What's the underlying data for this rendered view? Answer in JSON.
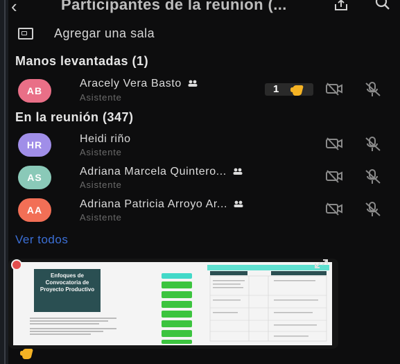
{
  "header": {
    "title": "Participantes de la reunion (...",
    "back_icon": "back-arrow-icon",
    "share_icon": "share-icon",
    "search_icon": "search-icon"
  },
  "room": {
    "label": "Agregar una sala",
    "icon": "room-icon"
  },
  "raised_hands": {
    "title": "Manos levantadas (1)",
    "participants": [
      {
        "initials": "AB",
        "name": "Aracely Vera Basto",
        "role": "Asistente",
        "color": "#e96f87",
        "hand_count": "1"
      }
    ]
  },
  "meeting": {
    "title": "En la reunión (347)",
    "participants": [
      {
        "initials": "HR",
        "name": "Heidi riño",
        "role": "Asistente",
        "color": "#a08ee8"
      },
      {
        "initials": "AS",
        "name": "Adriana Marcela Quintero...",
        "role": "Asistente",
        "color": "#8ac9b8"
      },
      {
        "initials": "AA",
        "name": "Adriana Patricia Arroyo Ar...",
        "role": "Asistente",
        "color": "#f26f56"
      }
    ]
  },
  "see_all": "Ver todos",
  "preview": {
    "slide_title": "Enfoques de Convocatoria de Proyecto Productivo"
  },
  "colors": {
    "background": "#0d0d0e",
    "accent_link": "#3b6fd6",
    "hand_yellow": "#f5b324"
  }
}
